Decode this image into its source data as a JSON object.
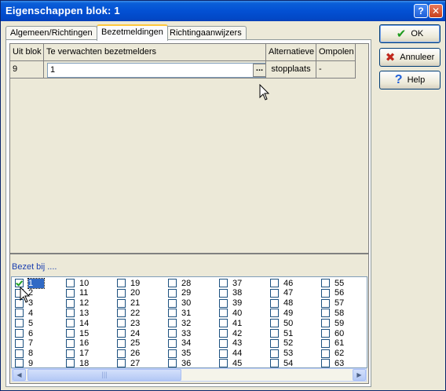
{
  "window": {
    "title": "Eigenschappen blok: 1"
  },
  "tabs": [
    {
      "label": "Algemeen/Richtingen"
    },
    {
      "label": "Bezetmeldingen"
    },
    {
      "label": "Richtingaanwijzers"
    }
  ],
  "grid": {
    "headers": [
      "Uit blok",
      "Te verwachten bezetmelders",
      "Alternatieve",
      "Ompolen"
    ],
    "row": {
      "uit_blok": "9",
      "melders": "1",
      "dots": "...",
      "alternatieve": "stopplaats",
      "ompolen": "-"
    }
  },
  "bezet": {
    "label": "Bezet bij ....",
    "columns": [
      [
        "1",
        "2",
        "3",
        "4",
        "5",
        "6",
        "7",
        "8",
        "9"
      ],
      [
        "10",
        "11",
        "12",
        "13",
        "14",
        "15",
        "16",
        "17",
        "18"
      ],
      [
        "19",
        "20",
        "21",
        "22",
        "23",
        "24",
        "25",
        "26",
        "27"
      ],
      [
        "28",
        "29",
        "30",
        "31",
        "32",
        "33",
        "34",
        "35",
        "36"
      ],
      [
        "37",
        "38",
        "39",
        "40",
        "41",
        "42",
        "43",
        "44",
        "45"
      ],
      [
        "46",
        "47",
        "48",
        "49",
        "50",
        "51",
        "52",
        "53",
        "54"
      ],
      [
        "55",
        "56",
        "57",
        "58",
        "59",
        "60",
        "61",
        "62",
        "63"
      ]
    ],
    "checked": [
      "1"
    ],
    "selected": "1"
  },
  "buttons": {
    "ok": "OK",
    "cancel": "Annuleer",
    "help": "Help"
  },
  "icons": {
    "ok": "checkmark-icon",
    "cancel": "x-icon",
    "help": "question-icon"
  },
  "colors": {
    "titlebar": "#0350d3",
    "selection": "#316ac5",
    "tab_highlight": "#ffc83c"
  }
}
